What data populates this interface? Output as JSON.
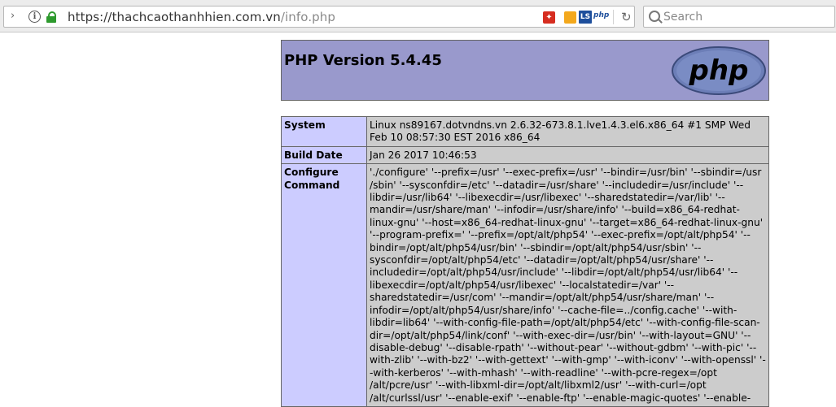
{
  "browser": {
    "url_host": "https://thachcaothanhhien.com.vn",
    "url_path": "/info.php",
    "search_placeholder": "Search",
    "extension_label": "php",
    "extension_ls": "LS"
  },
  "header": {
    "title": "PHP Version 5.4.45",
    "logo_text": "php"
  },
  "rows": [
    {
      "key": "System",
      "value": "Linux ns89167.dotvndns.vn 2.6.32-673.8.1.lve1.4.3.el6.x86_64 #1 SMP Wed Feb 10 08:57:30 EST 2016 x86_64"
    },
    {
      "key": "Build Date",
      "value": "Jan 26 2017 10:46:53"
    },
    {
      "key": "Configure Command",
      "value": "'./configure' '--prefix=/usr' '--exec-prefix=/usr' '--bindir=/usr/bin' '--sbindir=/usr /sbin' '--sysconfdir=/etc' '--datadir=/usr/share' '--includedir=/usr/include' '--libdir=/usr/lib64' '--libexecdir=/usr/libexec' '--sharedstatedir=/var/lib' '--mandir=/usr/share/man' '--infodir=/usr/share/info' '--build=x86_64-redhat-linux-gnu' '--host=x86_64-redhat-linux-gnu' '--target=x86_64-redhat-linux-gnu' '--program-prefix=' '--prefix=/opt/alt/php54' '--exec-prefix=/opt/alt/php54' '--bindir=/opt/alt/php54/usr/bin' '--sbindir=/opt/alt/php54/usr/sbin' '--sysconfdir=/opt/alt/php54/etc' '--datadir=/opt/alt/php54/usr/share' '--includedir=/opt/alt/php54/usr/include' '--libdir=/opt/alt/php54/usr/lib64' '--libexecdir=/opt/alt/php54/usr/libexec' '--localstatedir=/var' '--sharedstatedir=/usr/com' '--mandir=/opt/alt/php54/usr/share/man' '--infodir=/opt/alt/php54/usr/share/info' '--cache-file=../config.cache' '--with-libdir=lib64' '--with-config-file-path=/opt/alt/php54/etc' '--with-config-file-scan-dir=/opt/alt/php54/link/conf' '--with-exec-dir=/usr/bin' '--with-layout=GNU' '--disable-debug' '--disable-rpath' '--without-pear' '--without-gdbm' '--with-pic' '--with-zlib' '--with-bz2' '--with-gettext' '--with-gmp' '--with-iconv' '--with-openssl' '--with-kerberos' '--with-mhash' '--with-readline' '--with-pcre-regex=/opt /alt/pcre/usr' '--with-libxml-dir=/opt/alt/libxml2/usr' '--with-curl=/opt /alt/curlssl/usr' '--enable-exif' '--enable-ftp' '--enable-magic-quotes' '--enable-"
    }
  ]
}
